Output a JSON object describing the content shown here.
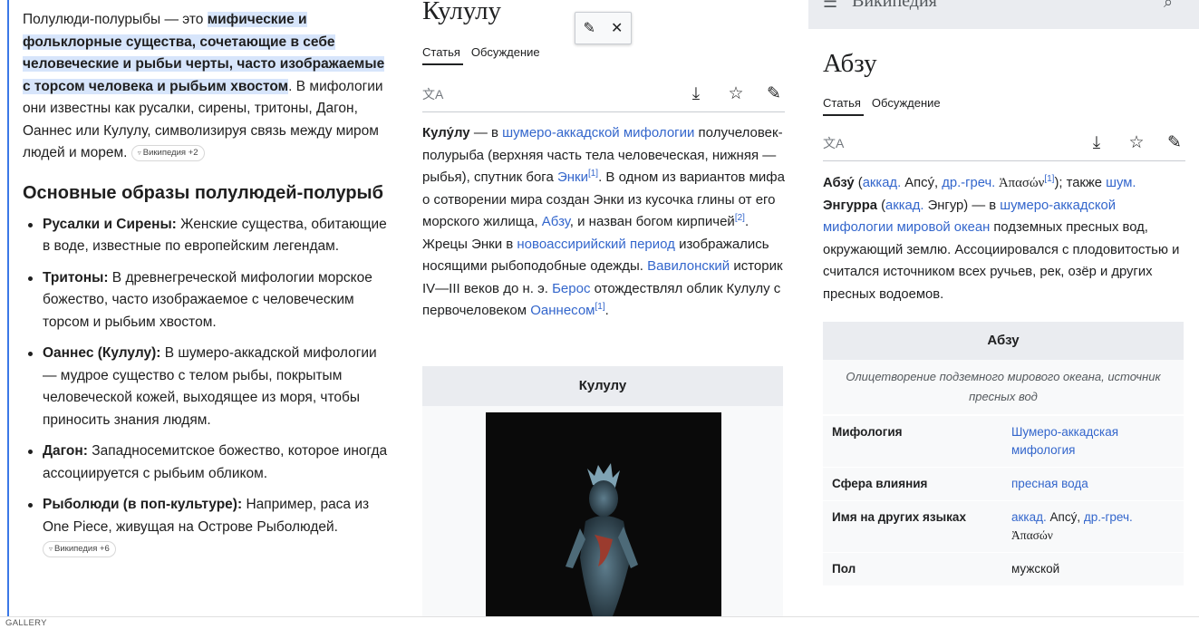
{
  "left_panel": {
    "intro_plain": "Полулюди-полурыбы — это ",
    "intro_highlight": "мифические и фольклорные существа, сочетающие в себе человеческие и рыбьи черты, часто изображаемые с торсом человека и рыбьим хвостом",
    "intro_rest": ". В мифологии они известны как русалки, сирены, тритоны, Дагон, Оаннес или Кулулу, символизируя связь между миром людей и морем.",
    "intro_chip": "Википедия +2",
    "heading": "Основные образы полулюдей-полурыб",
    "items": [
      {
        "term": "Русалки и Сирены:",
        "text": " Женские существа, обитающие в воде, известные по европейским легендам."
      },
      {
        "term": "Тритоны:",
        "text": " В древнегреческой мифологии морское божество, часто изображаемое с человеческим торсом и рыбьим хвостом."
      },
      {
        "term": "Оаннес (Кулулу):",
        "text": " В шумеро-аккадской мифологии — мудрое существо с телом рыбы, покрытым человеческой кожей, выходящее из моря, чтобы приносить знания людям."
      },
      {
        "term": "Дагон:",
        "text": " Западносемитское божество, которое иногда ассоциируется с рыбьим обликом."
      },
      {
        "term": "Рыболюди (в поп-культуре):",
        "text": " Например, раса из One Piece, живущая на Острове Рыболюдей."
      }
    ],
    "last_chip": "Википедия +6"
  },
  "middle_panel": {
    "title": "Кулулу",
    "tab_article": "Статья",
    "tab_discussion": "Обсуждение",
    "article": {
      "bold": "Кулу́лу",
      "t1": " — в ",
      "l1": "шумеро-аккадской мифологии",
      "t2": " получеловек-полурыба (верхняя часть тела человеческая, нижняя — рыбья), спутник бога ",
      "l2": "Энки",
      "s1": "[1]",
      "t3": ". В одном из вариантов мифа о сотворении мира создан Энки из кусочка глины от его морского жилища, ",
      "l3": "Абзу",
      "t4": ", и назван богом кирпичей",
      "s2": "[2]",
      "t5": ". Жрецы Энки в ",
      "l4": "новоассирийский период",
      "t6": " изображались носящими рыбоподобные одежды. ",
      "l5": "Вавилонский",
      "t7": " историк IV—III веков до н. э. ",
      "l6": "Берос",
      "t8": " отождествлял облик Кулулу с первочеловеком ",
      "l7": "Оаннесом",
      "s3": "[1]",
      "t9": "."
    },
    "infobox_title": "Кулулу"
  },
  "right_panel": {
    "header_partial": "Википедия",
    "title": "Абзу",
    "tab_article": "Статья",
    "tab_discussion": "Обсуждение",
    "article": {
      "bold1": "Абзу́",
      "p1": " (",
      "l1": "аккад.",
      "p2": " Апсý, ",
      "l2": "др.-греч.",
      "p3": " Ἀπασών",
      "s1": "[1]",
      "p4": "); также ",
      "l3": "шум.",
      "bold2": "Энгурра",
      "p5": " (",
      "l4": "аккад.",
      "p6": " Энгур) — в ",
      "l5": "шумеро-аккадской мифологии",
      "p7": " ",
      "l6": "мировой океан",
      "p8": " подземных пресных вод, окружающий землю. Ассоциировался с плодовитостью и считался источником всех ручьев, рек, озёр и других пресных водоемов."
    },
    "infobox": {
      "title": "Абзу",
      "caption": "Олицетворение подземного мирового океана, источник пресных вод",
      "rows": [
        {
          "key": "Мифология",
          "value": "Шумеро-аккадская мифология",
          "link": true
        },
        {
          "key": "Сфера влияния",
          "value": "пресная вода",
          "link": true
        },
        {
          "key": "Имя на других языках",
          "v1": "аккад.",
          "v2": " Апсý, ",
          "v3": "др.-греч.",
          "v4": "Ἀπασών"
        },
        {
          "key": "Пол",
          "value": "мужской",
          "link": false
        }
      ]
    }
  },
  "footer": {
    "label": "GALLERY"
  },
  "colors": {
    "link": "#3366cc",
    "highlight": "#d7e5fb",
    "accent_edge": "#3b78e7",
    "infobox_bg": "#f8f9fa",
    "infobox_head": "#eaecf0"
  }
}
